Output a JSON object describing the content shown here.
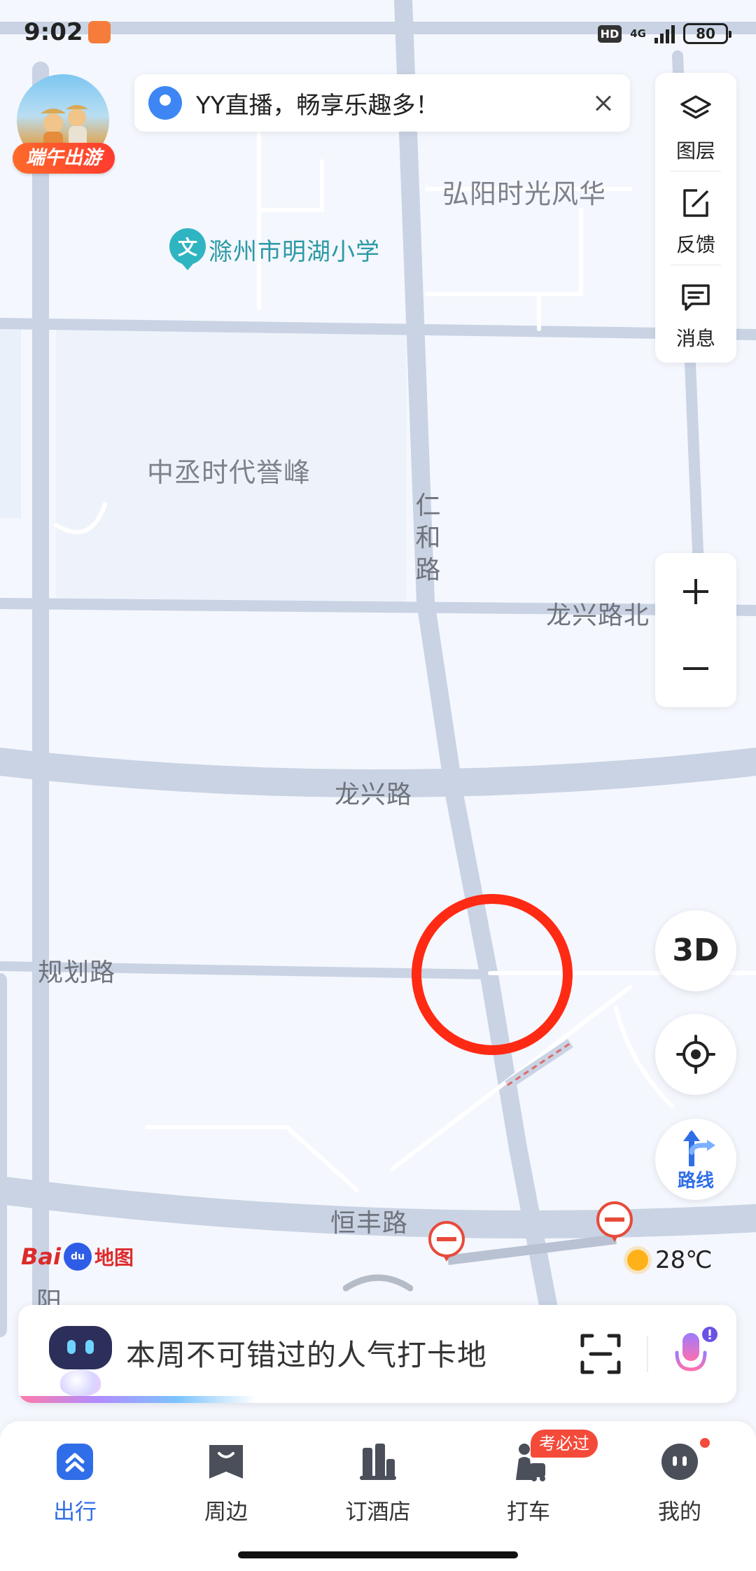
{
  "status_bar": {
    "time": "9:02",
    "hd": "HD",
    "network": "4G",
    "battery": "80"
  },
  "promo": {
    "label": "端午出游"
  },
  "notice": {
    "text": "YY直播，畅享乐趣多！",
    "icon": "location-pin-icon",
    "close_icon": "close-icon"
  },
  "tools": [
    {
      "label": "图层",
      "icon": "layers-icon"
    },
    {
      "label": "反馈",
      "icon": "edit-icon"
    },
    {
      "label": "消息",
      "icon": "message-icon"
    }
  ],
  "zoom": {
    "in_icon": "plus-icon",
    "out_icon": "minus-icon"
  },
  "map": {
    "place_labels": {
      "hongyang": "弘阳时光风华",
      "minghu_school": "滁州市明湖小学",
      "zhongcheng": "中丞时代誉峰",
      "renhe_road": "仁和路",
      "longxing_north": "龙兴路北",
      "longxing_road": "龙兴路",
      "guihua_road": "规划路",
      "hengfeng_road": "恒丰路",
      "yang": "阳"
    },
    "poi_badge": "文",
    "marker_color": "#ff2a14"
  },
  "controls": {
    "three_d": "3D",
    "locate_icon": "locate-icon",
    "route_label": "路线",
    "route_icon": "route-arrow-icon"
  },
  "logo": {
    "bai": "Bai",
    "du": "du",
    "map": "地图"
  },
  "weather": {
    "temperature": "28℃",
    "icon": "sun-icon"
  },
  "search": {
    "placeholder": "本周不可错过的人气打卡地",
    "scan_icon": "scan-icon",
    "mic_icon": "mic-icon"
  },
  "nav": [
    {
      "label": "出行",
      "icon": "travel-icon",
      "active": true
    },
    {
      "label": "周边",
      "icon": "nearby-icon"
    },
    {
      "label": "订酒店",
      "icon": "hotel-icon"
    },
    {
      "label": "打车",
      "icon": "taxi-icon"
    },
    {
      "label": "我的",
      "icon": "profile-icon"
    }
  ],
  "nav_badge": "考必过",
  "colors": {
    "accent": "#2f6ee8",
    "road": "#c8d2e3",
    "map_bg": "#f4f7fd",
    "alert": "#f44a3a"
  }
}
